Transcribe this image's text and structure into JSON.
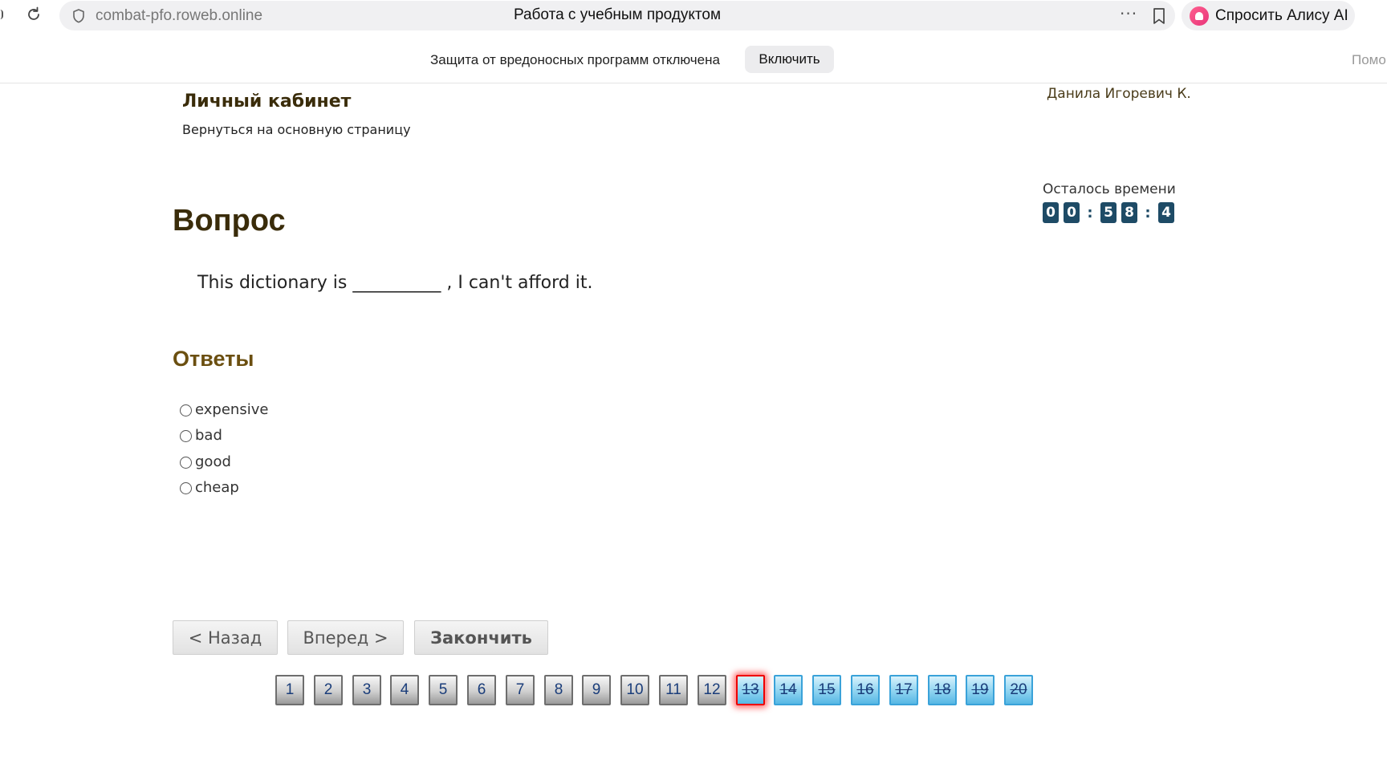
{
  "browser": {
    "url": "combat-pfo.roweb.online",
    "tab_title": "Работа с учебным продуктом",
    "more_label": "···",
    "alice_label": "Спросить Алису AI",
    "security_message": "Защита от вредоносных программ отключена",
    "enable_button": "Включить",
    "help_text": "Помо"
  },
  "header": {
    "title": "Личный кабинет",
    "back_link": "Вернуться на основную страницу",
    "user_name": "Данила Игоревич К."
  },
  "timer": {
    "label": "Осталось времени",
    "digits": [
      "0",
      "0",
      ":",
      "5",
      "8",
      ":",
      "4"
    ]
  },
  "question": {
    "heading": "Вопрос",
    "text": "This dictionary is __________ , I can't afford it."
  },
  "answers": {
    "heading": "Ответы",
    "options": [
      "expensive",
      "bad",
      "good",
      "cheap"
    ]
  },
  "navigation": {
    "back": "< Назад",
    "next": "Вперед >",
    "finish": "Закончить"
  },
  "pagination": {
    "pages": [
      "1",
      "2",
      "3",
      "4",
      "5",
      "6",
      "7",
      "8",
      "9",
      "10",
      "11",
      "12",
      "13",
      "14",
      "15",
      "16",
      "17",
      "18",
      "19",
      "20"
    ],
    "current": "13",
    "answered_count": 12
  },
  "colors": {
    "heading_brown": "#3a2c0a",
    "answers_heading": "#6b4f10",
    "timer_digit_bg": "#1e4b66",
    "page_pending_bg": "#8ed3f0",
    "page_answered_bg": "#cfcfcf",
    "page_current_border": "#e00000"
  }
}
